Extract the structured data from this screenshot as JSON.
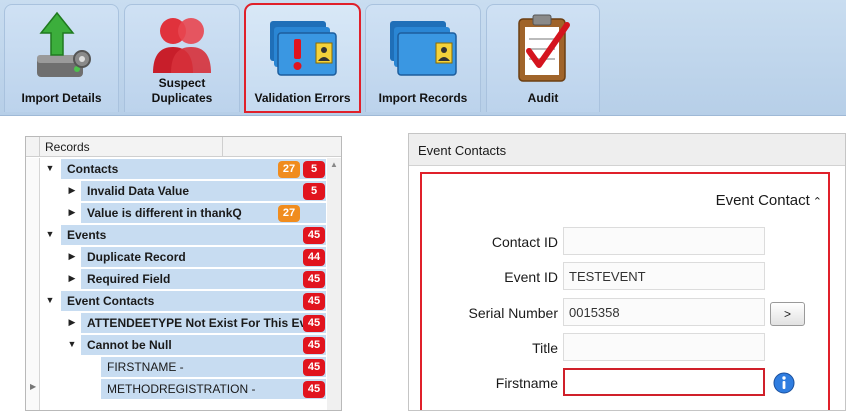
{
  "ribbon": {
    "tabs": [
      {
        "label": "Import Details",
        "icon": "import-details-icon",
        "selected": false
      },
      {
        "label": "Suspect\nDuplicates",
        "icon": "suspect-duplicates-icon",
        "selected": false
      },
      {
        "label": "Validation Errors",
        "icon": "validation-errors-icon",
        "selected": true
      },
      {
        "label": "Import Records",
        "icon": "import-records-icon",
        "selected": false
      },
      {
        "label": "Audit",
        "icon": "audit-clipboard-icon",
        "selected": false
      }
    ]
  },
  "tree": {
    "header": "Records",
    "rows": [
      {
        "label": "Contacts",
        "badges": [
          "27",
          "5"
        ]
      },
      {
        "label": "Invalid Data Value",
        "badges": [
          "5"
        ]
      },
      {
        "label": "Value is different in thankQ",
        "badges": [
          "27"
        ]
      },
      {
        "label": "Events",
        "badges": [
          "45"
        ]
      },
      {
        "label": "Duplicate Record",
        "badges": [
          "44"
        ]
      },
      {
        "label": "Required Field",
        "badges": [
          "45"
        ]
      },
      {
        "label": "Event Contacts",
        "badges": [
          "45"
        ]
      },
      {
        "label": "ATTENDEETYPE Not Exist For This Event",
        "badges": [
          "45"
        ]
      },
      {
        "label": "Cannot be Null",
        "badges": [
          "45"
        ]
      },
      {
        "label": "FIRSTNAME -",
        "badges": [
          "45"
        ]
      },
      {
        "label": "METHODREGISTRATION -",
        "badges": [
          "45"
        ]
      }
    ]
  },
  "event_contacts": {
    "panel_title": "Event Contacts",
    "group_title": "Event Contact",
    "fields": [
      {
        "label": "Contact ID",
        "value": ""
      },
      {
        "label": "Event ID",
        "value": "TESTEVENT"
      },
      {
        "label": "Serial Number",
        "value": "0015358"
      },
      {
        "label": "Title",
        "value": ""
      },
      {
        "label": "Firstname",
        "value": ""
      }
    ],
    "lookup_button": ">"
  },
  "colors": {
    "error_red": "#e1141e",
    "warning_orange": "#f08c1e",
    "selection_blue": "#c7dcf1",
    "ribbon_blue": "#c9ddf0"
  }
}
